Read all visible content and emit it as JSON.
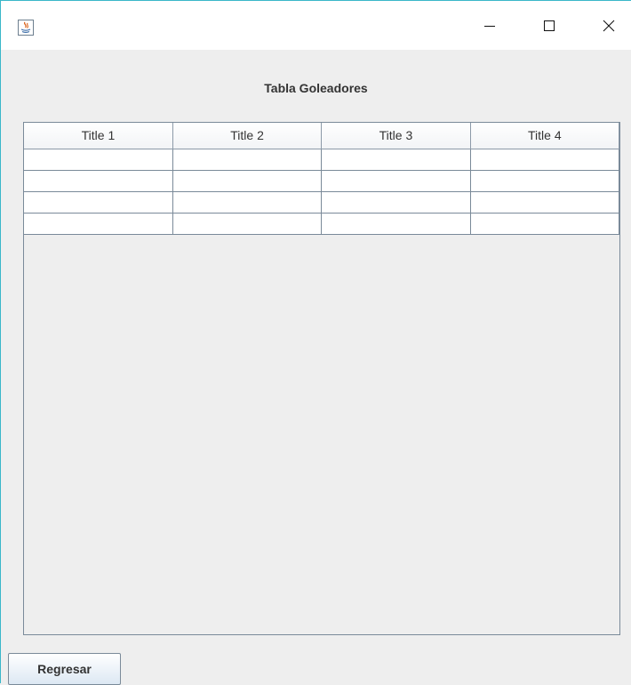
{
  "window": {
    "icon": "java-app-icon",
    "controls": {
      "minimize_icon": "minimize-icon",
      "maximize_icon": "maximize-icon",
      "close_icon": "close-icon"
    }
  },
  "main": {
    "heading": "Tabla Goleadores"
  },
  "table": {
    "columns": [
      "Title 1",
      "Title 2",
      "Title 3",
      "Title 4"
    ],
    "rows": [
      [
        "",
        "",
        "",
        ""
      ],
      [
        "",
        "",
        "",
        ""
      ],
      [
        "",
        "",
        "",
        ""
      ],
      [
        "",
        "",
        "",
        ""
      ]
    ]
  },
  "footer": {
    "back_label": "Regresar"
  },
  "colors": {
    "window_border": "#3ab7c9",
    "background": "#eeeeee",
    "grid_line": "#7a8a99"
  }
}
